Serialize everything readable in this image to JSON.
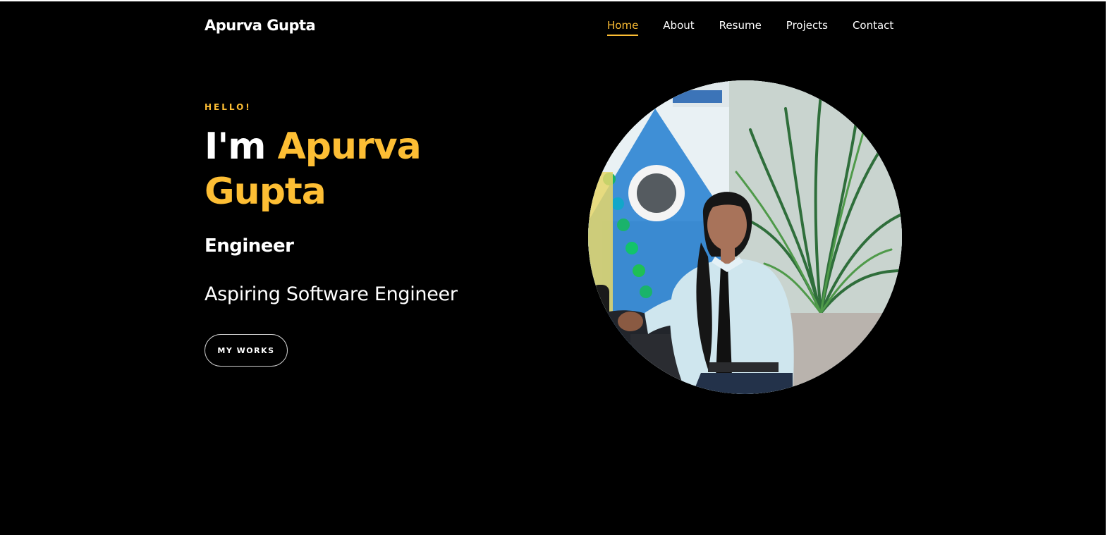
{
  "nav": {
    "brand": "Apurva Gupta",
    "items": [
      {
        "label": "Home",
        "active": true
      },
      {
        "label": "About",
        "active": false
      },
      {
        "label": "Resume",
        "active": false
      },
      {
        "label": "Projects",
        "active": false
      },
      {
        "label": "Contact",
        "active": false
      }
    ]
  },
  "hero": {
    "greeting": "HELLO!",
    "headline_prefix": "I'm ",
    "name_first": "Apurva",
    "name_last": "Gupta",
    "role": "Engineer",
    "tagline": "Aspiring Software Engineer",
    "button_label": "MY WORKS"
  },
  "colors": {
    "accent": "#fdbe34",
    "background": "#000000",
    "text": "#ffffff"
  }
}
